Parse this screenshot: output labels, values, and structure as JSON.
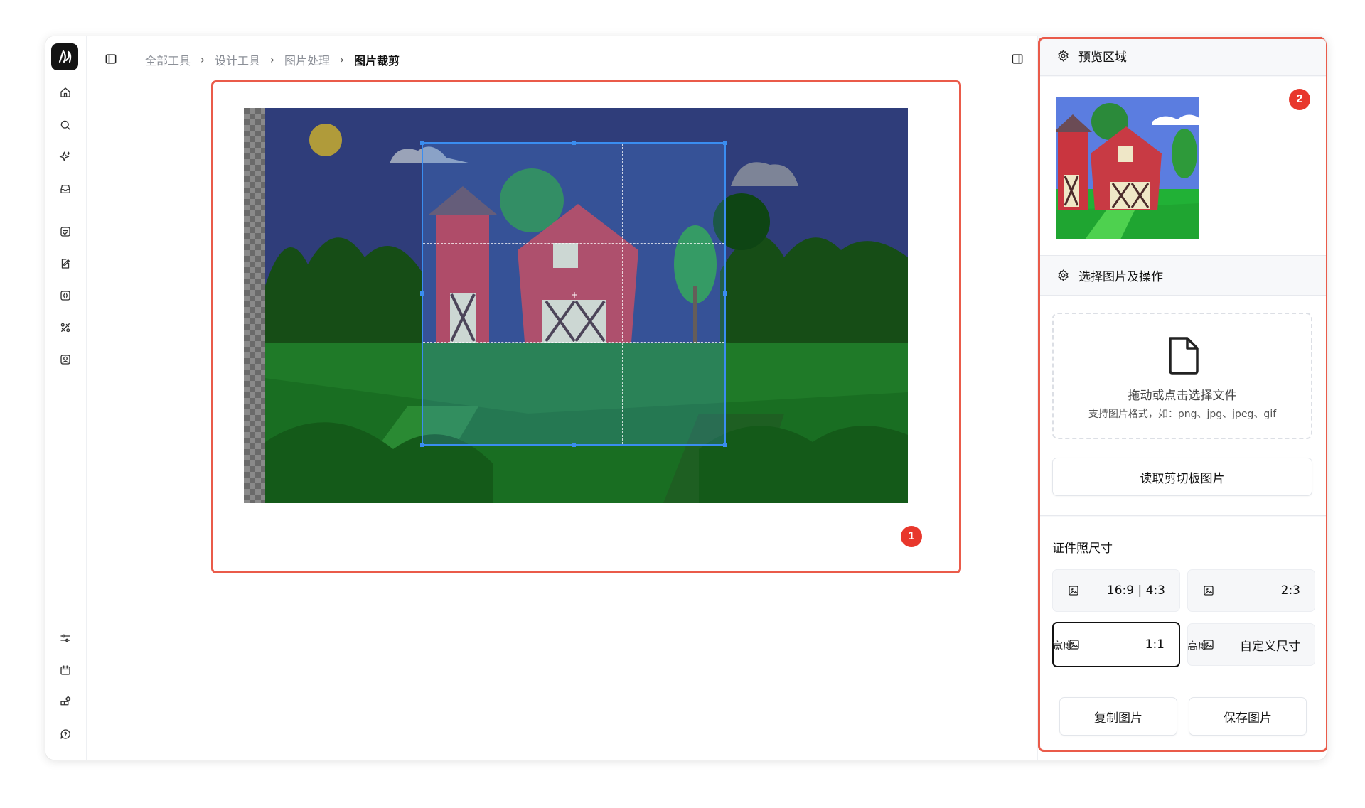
{
  "breadcrumb": {
    "items": [
      "全部工具",
      "设计工具",
      "图片处理",
      "图片裁剪"
    ],
    "separator": "›"
  },
  "sidebar": {
    "logo": "app-logo",
    "top_icons": [
      "home-icon",
      "search-icon",
      "sparkle-icon",
      "inbox-icon",
      "image-tool-icon",
      "edit-icon",
      "bracket-icon",
      "tools-icon",
      "portrait-icon"
    ],
    "bottom_icons": [
      "sliders-icon",
      "calendar-icon",
      "widgets-icon",
      "help-icon"
    ]
  },
  "editor": {
    "badge": "1"
  },
  "panel": {
    "badge": "2",
    "preview_title": "预览区域",
    "ops_title": "选择图片及操作",
    "dropzone_title": "拖动或点击选择文件",
    "dropzone_hint": "支持图片格式，如：png、jpg、jpeg、gif",
    "clipboard_button": "读取剪切板图片",
    "size_title": "证件照尺寸",
    "size_options": [
      "16:9 | 4:3",
      "2:3",
      "1:1",
      "自定义尺寸"
    ],
    "active_size": "1:1",
    "width_label": "宽度",
    "height_label": "高度",
    "copy_button": "复制图片",
    "save_button": "保存图片"
  },
  "colors": {
    "highlight": "#ea5b4a",
    "badge": "#e8372c",
    "crop_border": "#3a8df0"
  }
}
